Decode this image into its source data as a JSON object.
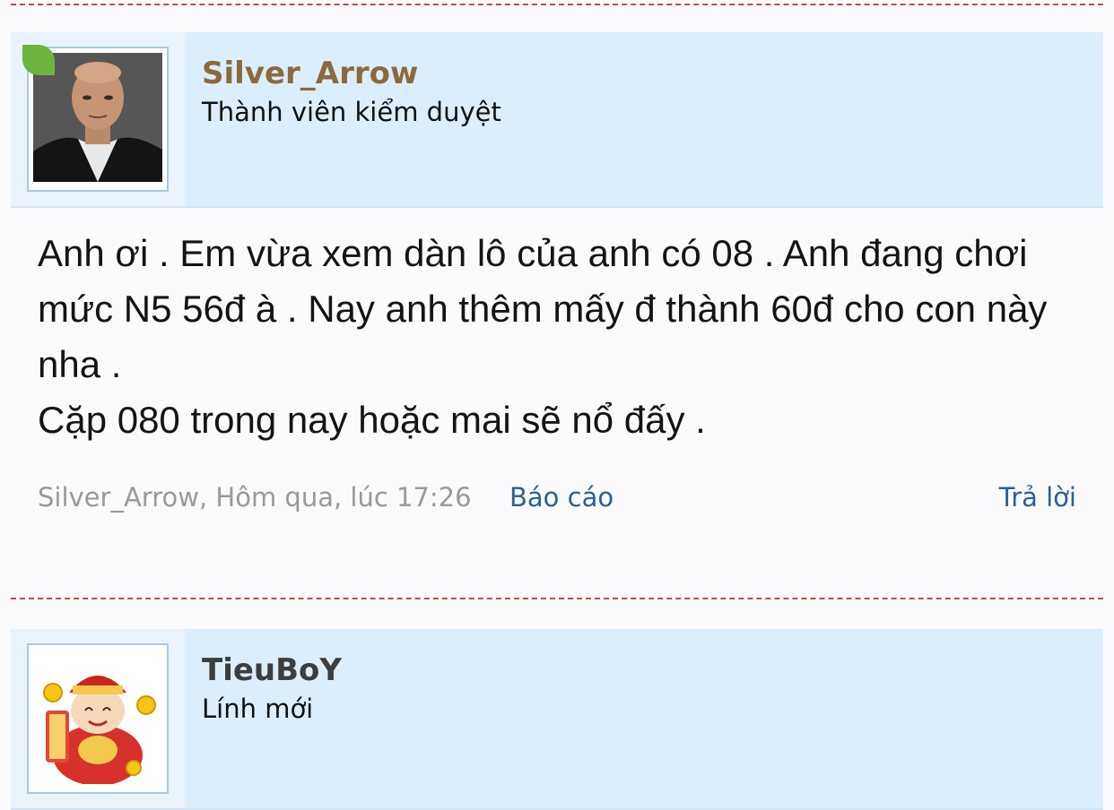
{
  "posts": [
    {
      "username": "Silver_Arrow",
      "user_title": "Thành viên kiểm duyệt",
      "username_color": "#8c6a3e",
      "message": "Anh ơi . Em vừa xem dàn lô của anh có 08 . Anh đang chơi mức N5 56đ à . Nay anh thêm mấy đ thành 60đ cho con này nha .\nCặp 080 trong nay hoặc mai sẽ nổ đấy .",
      "meta_author": "Silver_Arrow,",
      "meta_time": "Hôm qua, lúc 17:26",
      "report_label": "Báo cáo",
      "reply_label": "Trả lời"
    },
    {
      "username": "TieuBoY",
      "user_title": "Lính mới",
      "username_color": "#3d3d3d"
    }
  ],
  "colors": {
    "separator": "#c24a43",
    "link": "#2f5f94",
    "meta_text": "#999999",
    "userbar_bg": "#dceefc"
  }
}
